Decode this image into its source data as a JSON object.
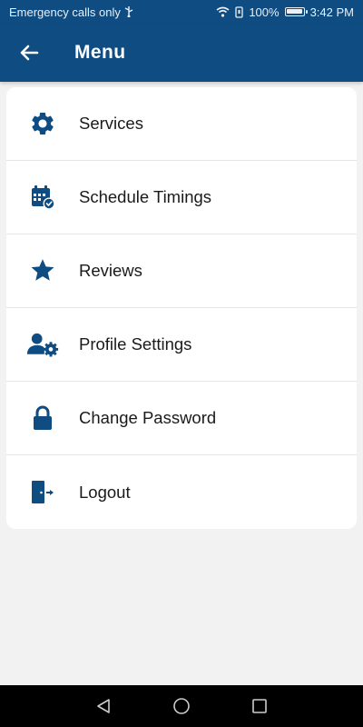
{
  "status_bar": {
    "carrier_text": "Emergency calls only",
    "battery_percent": "100%",
    "battery_level": 1.0,
    "time": "3:42 PM",
    "icons": [
      "usb-icon",
      "wifi-icon",
      "vibrate-icon",
      "battery-icon"
    ]
  },
  "app_bar": {
    "title": "Menu",
    "back_icon": "arrow-left-icon"
  },
  "menu": {
    "items": [
      {
        "label": "Services",
        "icon": "gear-icon"
      },
      {
        "label": "Schedule Timings",
        "icon": "calendar-check-icon"
      },
      {
        "label": "Reviews",
        "icon": "star-icon"
      },
      {
        "label": "Profile Settings",
        "icon": "user-gear-icon"
      },
      {
        "label": "Change Password",
        "icon": "lock-icon"
      },
      {
        "label": "Logout",
        "icon": "logout-door-icon"
      }
    ]
  },
  "nav_bar": {
    "buttons": [
      "back-triangle-icon",
      "home-circle-icon",
      "recents-square-icon"
    ]
  },
  "colors": {
    "primary": "#0f4c81",
    "background": "#f2f2f2",
    "card": "#ffffff",
    "icon": "#0f4c81",
    "text": "#1a1a1a"
  }
}
